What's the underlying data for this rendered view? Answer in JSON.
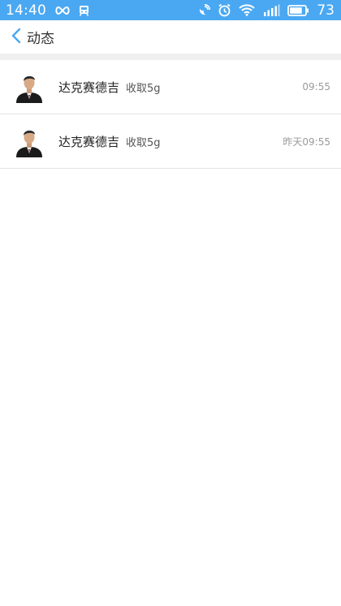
{
  "status_bar": {
    "time": "14:40",
    "battery": "73",
    "icons": [
      "infinity-icon",
      "train-icon",
      "satellite-icon",
      "alarm-icon",
      "wifi-icon",
      "signal-icon",
      "battery-icon"
    ]
  },
  "header": {
    "back_icon": "chevron-left-icon",
    "title": "动态"
  },
  "feed": [
    {
      "name": "达克赛德吉",
      "action": "收取5g",
      "time": "09:55"
    },
    {
      "name": "达克赛德吉",
      "action": "收取5g",
      "time": "昨天09:55"
    }
  ],
  "colors": {
    "status_bar": "#4aa8f2",
    "accent": "#4aa8f2",
    "separator_band": "#efefef"
  }
}
